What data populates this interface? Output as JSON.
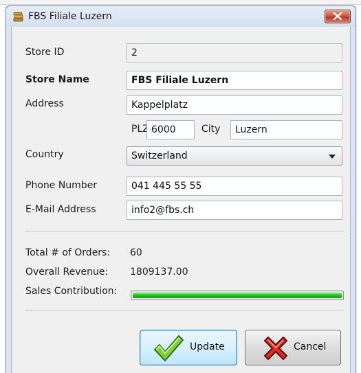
{
  "window": {
    "title": "FBS Filiale Luzern"
  },
  "form": {
    "store_id": {
      "label": "Store ID",
      "value": "2"
    },
    "store_name": {
      "label": "Store Name",
      "value": "FBS Filiale Luzern"
    },
    "address": {
      "label": "Address",
      "value": "Kappelplatz"
    },
    "plz": {
      "label": "PLZ",
      "value": "6000"
    },
    "city": {
      "label": "City",
      "value": "Luzern"
    },
    "country": {
      "label": "Country",
      "value": "Switzerland"
    },
    "phone": {
      "label": "Phone Number",
      "value": "041 445 55 55"
    },
    "email": {
      "label": "E-Mail Address",
      "value": "info2@fbs.ch"
    }
  },
  "stats": {
    "total_orders": {
      "label": "Total # of Orders:",
      "value": "60"
    },
    "revenue": {
      "label": "Overall Revenue:",
      "value": "1809137.00"
    },
    "sales_contribution": {
      "label": "Sales Contribution:",
      "fraction": 1.0,
      "color": "#15c715"
    }
  },
  "buttons": {
    "update": "Update",
    "cancel": "Cancel"
  },
  "icons": {
    "app": "store-icon",
    "close": "close-icon",
    "update": "checkmark-icon",
    "cancel": "red-x-icon",
    "dropdown": "chevron-down-icon"
  }
}
